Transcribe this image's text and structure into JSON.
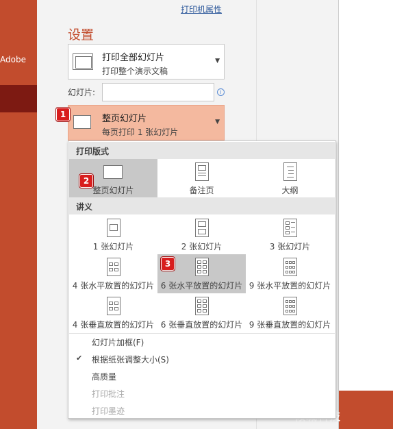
{
  "left_rail": {
    "adobe_label": "Adobe"
  },
  "header": {
    "printer_properties_link": "打印机属性"
  },
  "settings": {
    "title": "设置",
    "print_range": {
      "main": "打印全部幻灯片",
      "sub": "打印整个演示文稿"
    },
    "slides_label": "幻灯片:",
    "slides_input_value": "",
    "info_icon": "i",
    "layout_dropdown": {
      "main": "整页幻灯片",
      "sub": "每页打印 1 张幻灯片"
    }
  },
  "badges": [
    "1",
    "2",
    "3"
  ],
  "panel": {
    "print_layout_header": "打印版式",
    "print_layout_items": [
      "整页幻灯片",
      "备注页",
      "大纲"
    ],
    "handouts_header": "讲义",
    "handout_items": [
      "1 张幻灯片",
      "2 张幻灯片",
      "3 张幻灯片",
      "4 张水平放置的幻灯片",
      "6 张水平放置的幻灯片",
      "9 张水平放置的幻灯片",
      "4 张垂直放置的幻灯片",
      "6 张垂直放置的幻灯片",
      "9 张垂直放置的幻灯片"
    ],
    "options": [
      {
        "label": "幻灯片加框(F)",
        "checked": false,
        "enabled": true
      },
      {
        "label": "根据纸张调整大小(S)",
        "checked": true,
        "enabled": true
      },
      {
        "label": "高质量",
        "checked": false,
        "enabled": true
      },
      {
        "label": "打印批注",
        "checked": false,
        "enabled": false
      },
      {
        "label": "打印墨迹",
        "checked": false,
        "enabled": false
      }
    ],
    "checkmark": "✔"
  },
  "watermark": "倾城科技",
  "colors": {
    "accent": "#c24c2d",
    "selected_dropdown": "#f4b99f",
    "badge": "#d81e1e",
    "link": "#2b579a"
  }
}
